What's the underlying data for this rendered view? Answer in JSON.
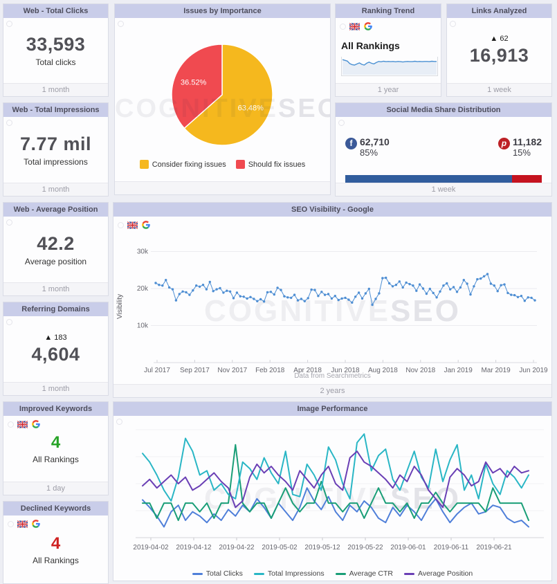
{
  "watermark": {
    "light": "COGNITIVE",
    "bold": "SEO"
  },
  "cards": {
    "total_clicks": {
      "title": "Web - Total Clicks",
      "value": "33,593",
      "label": "Total clicks",
      "footer": "1 month"
    },
    "issues": {
      "title": "Issues by Importance",
      "footer": ""
    },
    "ranking_trend": {
      "title": "Ranking Trend",
      "heading": "All Rankings",
      "footer": "1 year"
    },
    "links_analyzed": {
      "title": "Links Analyzed",
      "delta_text": "▲ 62",
      "value": "16,913",
      "footer": "1 week"
    },
    "total_impressions": {
      "title": "Web - Total Impressions",
      "value": "7.77 mil",
      "label": "Total impressions",
      "footer": "1 month"
    },
    "social": {
      "title": "Social Media Share Distribution",
      "footer": "1 week",
      "facebook": {
        "value": "62,710",
        "percent": "85%"
      },
      "pinterest": {
        "value": "11,182",
        "percent": "15%"
      },
      "bar": {
        "facebook_pct": 85,
        "pinterest_pct": 15,
        "facebook_color": "#315d9d",
        "pinterest_color": "#c5131f"
      }
    },
    "avg_position": {
      "title": "Web - Average Position",
      "value": "42.2",
      "label": "Average position",
      "footer": "1 month"
    },
    "referring_domains": {
      "title": "Referring Domains",
      "delta_text": "▲ 183",
      "value": "4,604",
      "footer": "1 month"
    },
    "improved_keywords": {
      "title": "Improved Keywords",
      "value": "4",
      "label": "All Rankings",
      "footer": "1 day"
    },
    "declined_keywords": {
      "title": "Declined Keywords",
      "value": "4",
      "label": "All Rankings"
    },
    "seo_visibility": {
      "title": "SEO Visibility - Google",
      "source": "Data from Searchmetrics",
      "footer": "2 years"
    },
    "image_performance": {
      "title": "Image Performance"
    }
  },
  "chart_data": [
    {
      "id": "issues_pie",
      "type": "pie",
      "title": "Issues by Importance",
      "labels": [
        "Consider fixing issues",
        "Should fix issues"
      ],
      "values": [
        63.48,
        36.52
      ],
      "value_labels": [
        "63.48%",
        "36.52%"
      ],
      "colors": [
        "#f5b81e",
        "#f04a50"
      ],
      "legend_position": "bottom"
    },
    {
      "id": "ranking_sparkline",
      "type": "area",
      "title": "All Rankings trend (1 year)",
      "ylim": [
        0,
        1
      ],
      "color": "#4a90d2",
      "fill": "#e8eef6",
      "values": [
        0.8,
        0.76,
        0.72,
        0.58,
        0.52,
        0.5,
        0.56,
        0.62,
        0.54,
        0.5,
        0.6,
        0.66,
        0.6,
        0.56,
        0.64,
        0.7,
        0.68,
        0.71,
        0.69,
        0.7,
        0.69,
        0.7,
        0.68,
        0.7,
        0.69,
        0.67,
        0.69,
        0.7,
        0.69,
        0.69,
        0.71,
        0.69,
        0.7,
        0.69,
        0.7,
        0.7,
        0.69,
        0.71,
        0.7,
        0.7
      ]
    },
    {
      "id": "seo_visibility",
      "type": "line",
      "title": "SEO Visibility - Google",
      "ylabel": "Visibility",
      "units": "thousands",
      "ylim": [
        0,
        33
      ],
      "ytick_values": [
        10,
        20,
        30
      ],
      "ytick_labels": [
        "10k",
        "20k",
        "30k"
      ],
      "x_labels": [
        "Jul 2017",
        "Sep 2017",
        "Nov 2017",
        "Feb 2018",
        "Apr 2018",
        "Jun 2018",
        "Aug 2018",
        "Nov 2018",
        "Jan 2019",
        "Mar 2019",
        "Jun 2019"
      ],
      "color": "#4e8ed3",
      "grid": true,
      "values": [
        21.5,
        21.0,
        20.8,
        22.3,
        20.3,
        19.8,
        16.8,
        18.5,
        19.2,
        19.0,
        18.3,
        19.5,
        20.8,
        20.5,
        21.0,
        19.8,
        21.8,
        19.3,
        19.8,
        20.1,
        18.9,
        19.4,
        19.2,
        17.4,
        18.9,
        17.9,
        17.8,
        17.3,
        17.7,
        17.2,
        16.6,
        17.1,
        16.5,
        19.0,
        19.1,
        18.4,
        20.2,
        19.6,
        17.9,
        17.6,
        17.5,
        18.3,
        16.8,
        17.2,
        16.6,
        17.4,
        19.7,
        19.6,
        18.0,
        19.1,
        18.3,
        18.5,
        17.3,
        18.0,
        16.9,
        17.3,
        17.5,
        17.0,
        16.2,
        17.8,
        18.9,
        17.3,
        18.7,
        19.9,
        15.6,
        17.2,
        18.7,
        22.8,
        22.9,
        21.4,
        20.6,
        21.0,
        21.9,
        20.3,
        21.6,
        21.2,
        20.8,
        19.4,
        21.1,
        20.0,
        18.6,
        19.9,
        18.8,
        17.6,
        19.2,
        20.8,
        21.4,
        19.8,
        20.4,
        19.1,
        20.3,
        22.3,
        21.3,
        18.4,
        20.6,
        22.5,
        22.7,
        23.3,
        23.9,
        21.3,
        20.8,
        19.3,
        20.9,
        21.1,
        18.8,
        18.3,
        18.2,
        17.7,
        18.0,
        16.7,
        17.6,
        17.5,
        16.8
      ],
      "source": "Data from Searchmetrics"
    },
    {
      "id": "image_performance",
      "type": "line",
      "title": "Image Performance",
      "ylim": [
        0,
        100
      ],
      "grid": true,
      "legend_position": "bottom",
      "x_labels": [
        "2019-04-02",
        "2019-04-12",
        "2019-04-22",
        "2019-05-02",
        "2019-05-12",
        "2019-05-22",
        "2019-06-01",
        "2019-06-11",
        "2019-06-21"
      ],
      "series": [
        {
          "name": "Total Clicks",
          "color": "#4f7fd9",
          "values": [
            35,
            28,
            20,
            10,
            24,
            30,
            16,
            24,
            20,
            14,
            22,
            16,
            26,
            20,
            30,
            24,
            36,
            28,
            18,
            32,
            24,
            16,
            28,
            46,
            34,
            26,
            38,
            24,
            16,
            30,
            24,
            34,
            28,
            18,
            14,
            28,
            20,
            30,
            24,
            16,
            28,
            36,
            24,
            14,
            22,
            28,
            32,
            22,
            24,
            30,
            28,
            18,
            14,
            16,
            10
          ]
        },
        {
          "name": "Total Impressions",
          "color": "#29b6c5",
          "values": [
            78,
            70,
            58,
            44,
            34,
            56,
            92,
            80,
            58,
            62,
            44,
            50,
            40,
            36,
            70,
            64,
            54,
            74,
            60,
            50,
            80,
            40,
            38,
            68,
            58,
            44,
            84,
            72,
            50,
            36,
            88,
            96,
            62,
            76,
            82,
            54,
            44,
            62,
            80,
            56,
            46,
            82,
            52,
            72,
            86,
            44,
            58,
            36,
            68,
            50,
            40,
            62,
            56,
            46,
            58
          ]
        },
        {
          "name": "Average CTR",
          "color": "#199e77",
          "values": [
            32,
            32,
            18,
            32,
            32,
            16,
            32,
            32,
            24,
            32,
            18,
            32,
            32,
            86,
            32,
            24,
            32,
            32,
            18,
            32,
            46,
            32,
            24,
            32,
            32,
            52,
            32,
            32,
            24,
            32,
            32,
            18,
            32,
            46,
            32,
            32,
            24,
            32,
            18,
            32,
            32,
            42,
            32,
            24,
            32,
            32,
            32,
            32,
            24,
            46,
            32,
            32,
            32,
            32,
            16
          ]
        },
        {
          "name": "Average Position",
          "color": "#6a3fb5",
          "values": [
            48,
            54,
            46,
            52,
            58,
            50,
            56,
            44,
            48,
            54,
            60,
            52,
            46,
            28,
            34,
            56,
            68,
            60,
            66,
            58,
            52,
            44,
            62,
            54,
            46,
            58,
            66,
            50,
            44,
            74,
            80,
            70,
            66,
            60,
            54,
            46,
            58,
            52,
            66,
            58,
            44,
            36,
            28,
            56,
            64,
            58,
            48,
            52,
            70,
            60,
            64,
            56,
            66,
            60,
            62
          ]
        }
      ]
    }
  ]
}
